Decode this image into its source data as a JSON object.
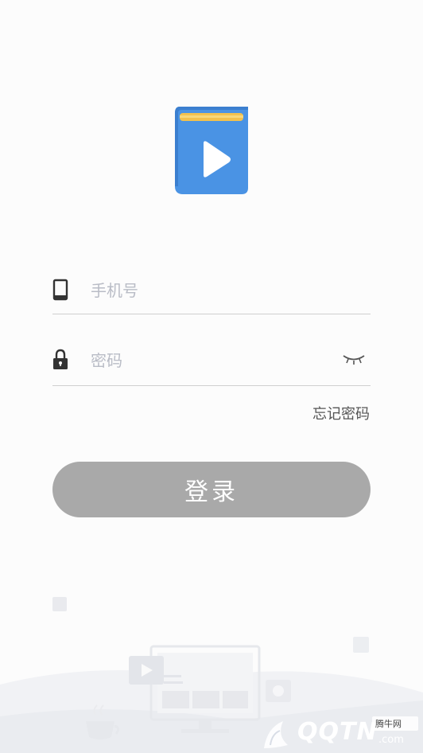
{
  "phone": {
    "placeholder": "手机号"
  },
  "password": {
    "placeholder": "密码"
  },
  "forgot_label": "忘记密码",
  "login_label": "登录",
  "watermark": {
    "brand": "QQTN",
    "site": "腾牛网",
    "com": ".com"
  },
  "colors": {
    "logo_blue": "#4a93e4",
    "logo_yellow": "#f2c14e",
    "button_gray": "#a9a9a9",
    "divider": "#cfcfcf"
  },
  "icons": {
    "phone": "phone-icon",
    "lock": "lock-icon",
    "eye": "eye-closed-icon"
  }
}
